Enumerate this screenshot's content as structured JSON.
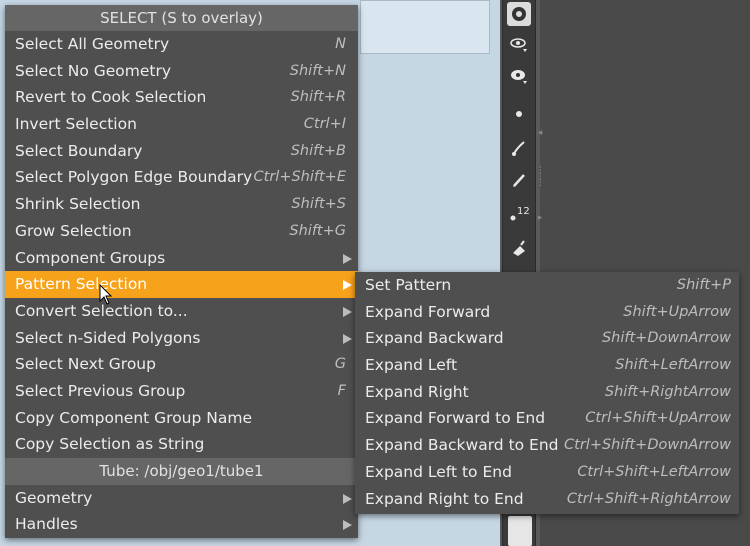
{
  "menu": {
    "header": "SELECT (S to overlay)",
    "items": [
      {
        "label": "Select All Geometry",
        "shortcut": "N"
      },
      {
        "label": "Select No Geometry",
        "shortcut": "Shift+N"
      },
      {
        "label": "Revert to Cook Selection",
        "shortcut": "Shift+R"
      },
      {
        "label": "Invert Selection",
        "shortcut": "Ctrl+I"
      },
      {
        "label": "Select Boundary",
        "shortcut": "Shift+B"
      },
      {
        "label": "Select Polygon Edge Boundary",
        "shortcut": "Ctrl+Shift+E"
      },
      {
        "label": "Shrink Selection",
        "shortcut": "Shift+S"
      },
      {
        "label": "Grow Selection",
        "shortcut": "Shift+G"
      },
      {
        "label": "Component Groups",
        "shortcut": ""
      },
      {
        "label": "Pattern Selection",
        "shortcut": ""
      },
      {
        "label": "Convert Selection to...",
        "shortcut": ""
      },
      {
        "label": "Select n-Sided Polygons",
        "shortcut": ""
      },
      {
        "label": "Select Next Group",
        "shortcut": "G"
      },
      {
        "label": "Select Previous Group",
        "shortcut": "F"
      },
      {
        "label": "Copy Component Group Name",
        "shortcut": ""
      },
      {
        "label": "Copy Selection as String",
        "shortcut": ""
      }
    ],
    "section_header": "Tube: /obj/geo1/tube1",
    "section_items": [
      {
        "label": "Geometry"
      },
      {
        "label": "Handles"
      }
    ]
  },
  "submenu": {
    "items": [
      {
        "label": "Set Pattern",
        "shortcut": "Shift+P"
      },
      {
        "label": "Expand Forward",
        "shortcut": "Shift+UpArrow"
      },
      {
        "label": "Expand Backward",
        "shortcut": "Shift+DownArrow"
      },
      {
        "label": "Expand Left",
        "shortcut": "Shift+LeftArrow"
      },
      {
        "label": "Expand Right",
        "shortcut": "Shift+RightArrow"
      },
      {
        "label": "Expand Forward to End",
        "shortcut": "Ctrl+Shift+UpArrow"
      },
      {
        "label": "Expand Backward to End",
        "shortcut": "Ctrl+Shift+DownArrow"
      },
      {
        "label": "Expand Left to End",
        "shortcut": "Ctrl+Shift+LeftArrow"
      },
      {
        "label": "Expand Right to End",
        "shortcut": "Ctrl+Shift+RightArrow"
      }
    ]
  },
  "toolbar": {
    "number_badge": "12",
    "icons": [
      "select-tool-icon",
      "view-tool-icon",
      "paint-tool-icon",
      "point-icon",
      "brush-icon",
      "pen-icon",
      "numbered-points-icon",
      "paint-bucket-icon"
    ]
  },
  "colors": {
    "highlight": "#f7a21b",
    "menu_bg": "#4f4f4f",
    "header_bg": "#666666"
  }
}
